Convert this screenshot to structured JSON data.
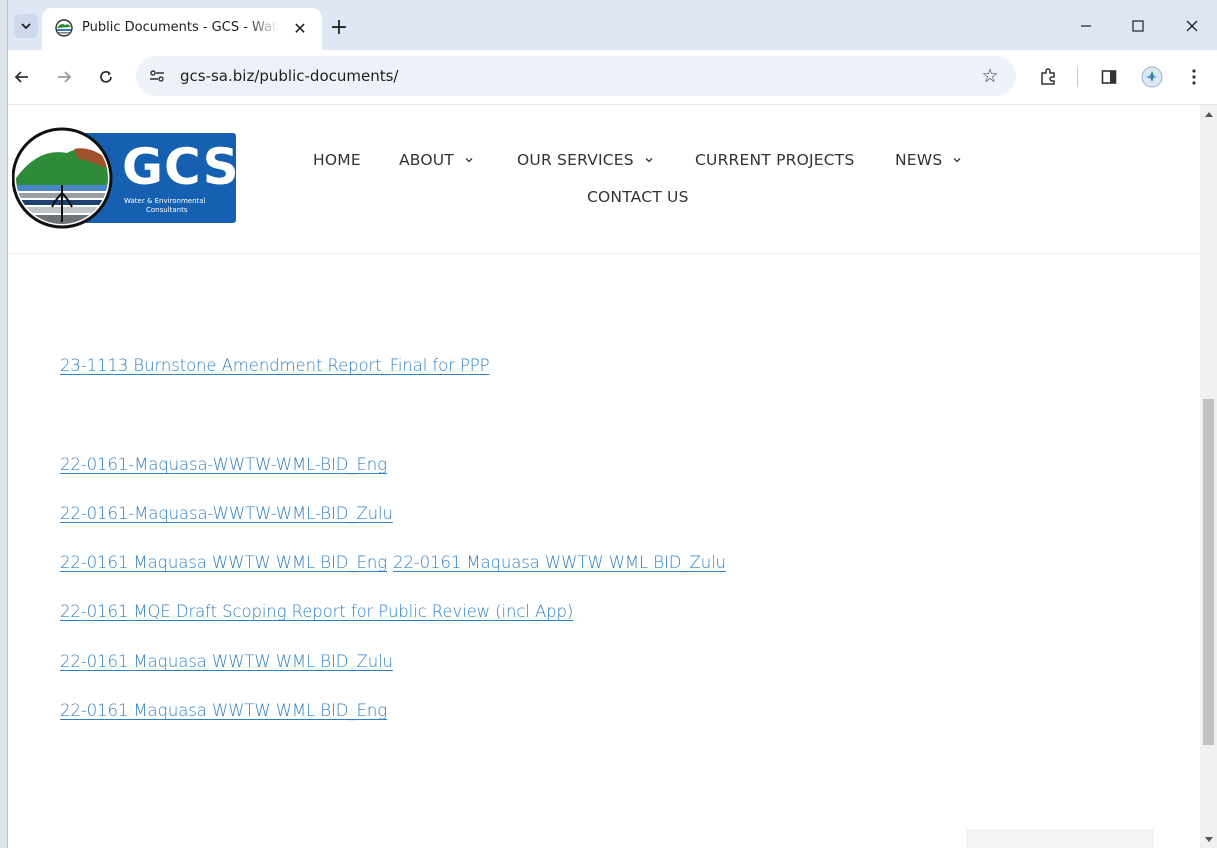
{
  "browser": {
    "tab_title": "Public Documents - GCS - Water & Environmental Consultants",
    "close_tab_glyph": "✕",
    "new_tab_glyph": "+",
    "url": "gcs-sa.biz/public-documents/",
    "window_controls": {
      "minimize": "—",
      "maximize": "☐",
      "close": "✕"
    }
  },
  "site": {
    "logo": {
      "text": "GCS",
      "line1": "Water & Environmental",
      "line2": "Consultants",
      "brand_color": "#1560b0"
    },
    "nav": {
      "home": "HOME",
      "about": "ABOUT",
      "services": "OUR SERVICES",
      "projects": "CURRENT PROJECTS",
      "news": "NEWS",
      "contact": "CONTACT US"
    }
  },
  "documents": {
    "link_color": "#2f7fc1",
    "burnstone": "23-1113 Burnstone Amendment Report_Final for PPP",
    "maquasa_bid_eng_dash": "22-0161-Maquasa-WWTW-WML-BID_Eng",
    "maquasa_bid_zulu_dash": "22-0161-Maquasa-WWTW-WML-BID_Zulu",
    "maquasa_bid_eng_a": "22-0161 Maquasa WWTW WML BID_Eng",
    "maquasa_bid_zulu_a": "22-0161 Maquasa WWTW WML BID_Zulu",
    "mqe_scoping": "22-0161 MQE Draft Scoping Report for Public Review (incl App)",
    "maquasa_bid_zulu_b": "22-0161 Maquasa WWTW WML BID_Zulu",
    "maquasa_bid_eng_b": "22-0161 Maquasa WWTW WML BID_Eng"
  }
}
